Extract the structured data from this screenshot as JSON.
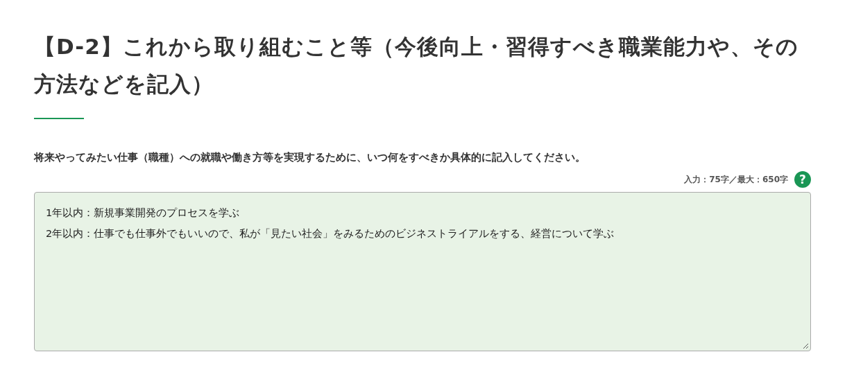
{
  "heading": "【D-2】これから取り組むこと等（今後向上・習得すべき職業能力や、その方法などを記入）",
  "instruction": "将来やってみたい仕事（職種）への就職や働き方等を実現するために、いつ何をすべきか具体的に記入してください。",
  "counter": "入力：75字／最大：650字",
  "help_button": "?",
  "answer": {
    "lines": [
      "1年以内：新規事業開発のプロセスを学ぶ",
      "2年以内：仕事でも仕事外でもいいので、私が「見たい社会」をみるためのビジネストライアルをする、経営について学ぶ"
    ]
  }
}
